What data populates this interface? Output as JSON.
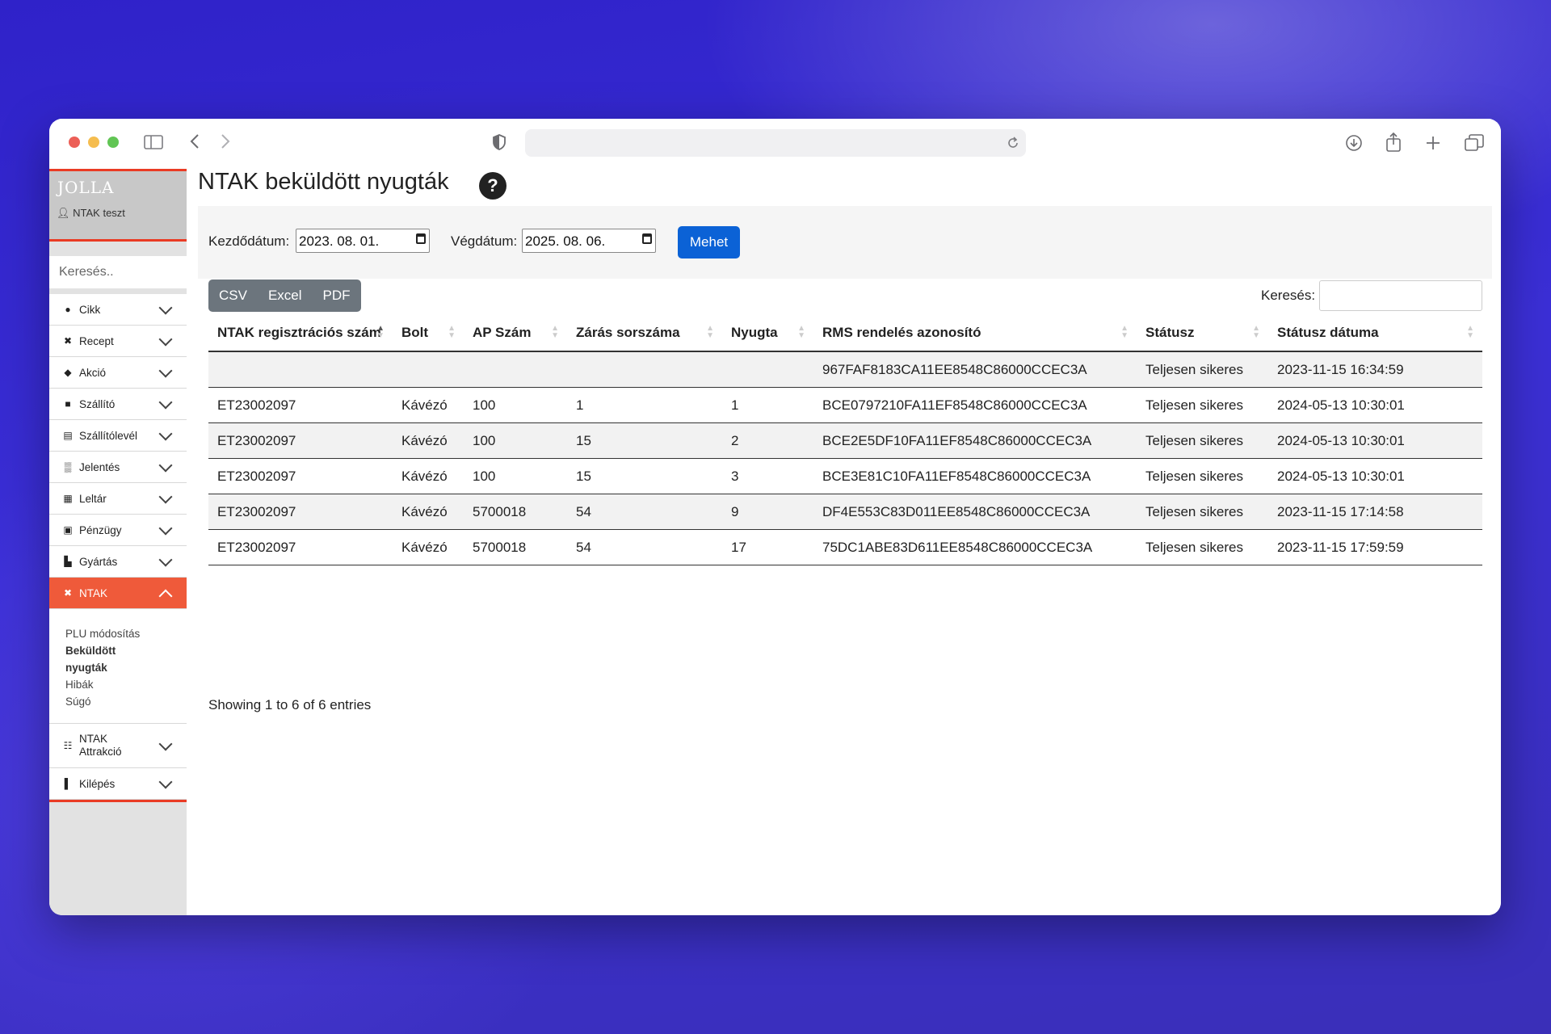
{
  "browser": {
    "traffic_colors": [
      "#ec5f57",
      "#f5bd4f",
      "#61c554"
    ]
  },
  "sidebar": {
    "logo": "JOLLA",
    "user": "NTAK teszt",
    "search_placeholder": "Keresés..",
    "items": [
      {
        "label": "Cikk",
        "icon": "apple-icon"
      },
      {
        "label": "Recept",
        "icon": "utensils-icon"
      },
      {
        "label": "Akció",
        "icon": "tags-icon"
      },
      {
        "label": "Szállító",
        "icon": "truck-icon"
      },
      {
        "label": "Szállítólevél",
        "icon": "store-icon"
      },
      {
        "label": "Jelentés",
        "icon": "chart-icon"
      },
      {
        "label": "Leltár",
        "icon": "boxes-icon"
      },
      {
        "label": "Pénzügy",
        "icon": "money-icon"
      },
      {
        "label": "Gyártás",
        "icon": "industry-icon"
      }
    ],
    "active": {
      "label": "NTAK",
      "icon": "utensils-icon"
    },
    "submenu": [
      "PLU módosítás",
      "Beküldött",
      "nyugták",
      "Hibák",
      "Súgó"
    ],
    "attrakcio": {
      "line1": "NTAK",
      "line2": "Attrakció"
    },
    "logout": "Kilépés"
  },
  "main": {
    "title": "NTAK beküldött nyugták",
    "help": "?",
    "start_label": "Kezdődátum:",
    "start_value": "2023. 08. 01.",
    "end_label": "Végdátum:",
    "end_value": "2025. 08. 06.",
    "go": "Mehet",
    "exports": [
      "CSV",
      "Excel",
      "PDF"
    ],
    "search_label": "Keresés:",
    "columns": [
      "NTAK regisztrációs szám",
      "Bolt",
      "AP Szám",
      "Zárás sorszáma",
      "Nyugta",
      "RMS rendelés azonosító",
      "Státusz",
      "Státusz dátuma"
    ],
    "rows": [
      [
        "",
        "",
        "",
        "",
        "",
        "967FAF8183CA11EE8548C86000CCEC3A",
        "Teljesen sikeres",
        "2023-11-15 16:34:59"
      ],
      [
        "ET23002097",
        "Kávézó",
        "100",
        "1",
        "1",
        "BCE0797210FA11EF8548C86000CCEC3A",
        "Teljesen sikeres",
        "2024-05-13 10:30:01"
      ],
      [
        "ET23002097",
        "Kávézó",
        "100",
        "15",
        "2",
        "BCE2E5DF10FA11EF8548C86000CCEC3A",
        "Teljesen sikeres",
        "2024-05-13 10:30:01"
      ],
      [
        "ET23002097",
        "Kávézó",
        "100",
        "15",
        "3",
        "BCE3E81C10FA11EF8548C86000CCEC3A",
        "Teljesen sikeres",
        "2024-05-13 10:30:01"
      ],
      [
        "ET23002097",
        "Kávézó",
        "5700018",
        "54",
        "9",
        "DF4E553C83D011EE8548C86000CCEC3A",
        "Teljesen sikeres",
        "2023-11-15 17:14:58"
      ],
      [
        "ET23002097",
        "Kávézó",
        "5700018",
        "54",
        "17",
        "75DC1ABE83D611EE8548C86000CCEC3A",
        "Teljesen sikeres",
        "2023-11-15 17:59:59"
      ]
    ],
    "info": "Showing 1 to 6 of 6 entries"
  }
}
